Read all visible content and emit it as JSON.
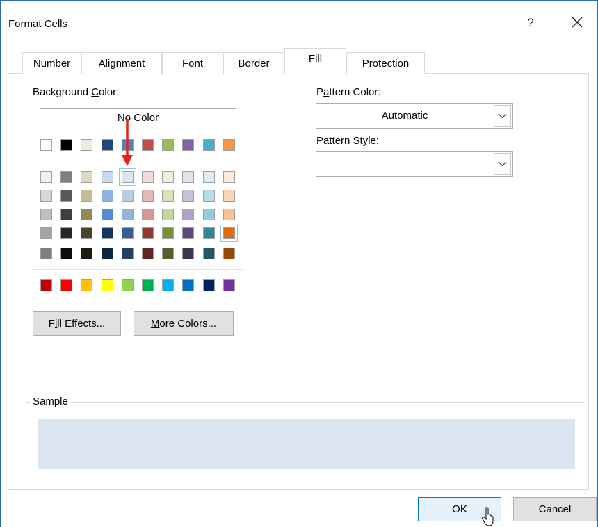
{
  "dialog": {
    "title": "Format Cells",
    "help": "?"
  },
  "tabs": [
    {
      "label": "Number"
    },
    {
      "label": "Alignment"
    },
    {
      "label": "Font"
    },
    {
      "label": "Border"
    },
    {
      "label": "Fill",
      "active": true
    },
    {
      "label": "Protection"
    }
  ],
  "background": {
    "label_pre": "Background ",
    "label_u": "C",
    "label_post": "olor:",
    "no_color": "No Color",
    "selected_color": "#dce6f1",
    "row_theme": [
      "#ffffff",
      "#000000",
      "#eeece1",
      "#1f497d",
      "#4f81bd",
      "#c0504d",
      "#9bbb59",
      "#8064a2",
      "#4bacc6",
      "#f79646"
    ],
    "shades": [
      [
        "#f2f2f2",
        "#7f7f7f",
        "#ddd9c3",
        "#c6d9f0",
        "#dce6f1",
        "#f2dcdb",
        "#ebf1dd",
        "#e5e0ec",
        "#dbeef3",
        "#fdeada"
      ],
      [
        "#d8d8d8",
        "#595959",
        "#c4bd97",
        "#8db3e2",
        "#b8cce4",
        "#e5b9b7",
        "#d7e3bc",
        "#ccc1d9",
        "#b7dde8",
        "#fbd5b5"
      ],
      [
        "#bfbfbf",
        "#3f3f3f",
        "#938953",
        "#548dd4",
        "#95b3d7",
        "#d99694",
        "#c3d69b",
        "#b2a2c7",
        "#92cddc",
        "#fac08f"
      ],
      [
        "#a5a5a5",
        "#262626",
        "#494429",
        "#17365d",
        "#366092",
        "#953734",
        "#76923c",
        "#5f497a",
        "#31859b",
        "#e36c09"
      ],
      [
        "#7f7f7f",
        "#0c0c0c",
        "#1d1b10",
        "#0f243e",
        "#244061",
        "#632423",
        "#4f6128",
        "#3f3151",
        "#205867",
        "#974806"
      ]
    ],
    "standard": [
      "#c00000",
      "#ff0000",
      "#ffc000",
      "#ffff00",
      "#92d050",
      "#00b050",
      "#00b0f0",
      "#0070c0",
      "#002060",
      "#7030a0"
    ]
  },
  "buttons": {
    "fill_effects_pre": "F",
    "fill_effects_u": "i",
    "fill_effects_post": "ll Effects...",
    "more_colors_u": "M",
    "more_colors_post": "ore Colors...",
    "ok": "OK",
    "cancel": "Cancel"
  },
  "pattern": {
    "color_label_pre": "P",
    "color_label_u": "a",
    "color_label_post": "ttern Color:",
    "color_value": "Automatic",
    "style_label_u": "P",
    "style_label_post": "attern Style:",
    "style_value": ""
  },
  "sample": {
    "label": "Sample",
    "color": "#dce6f1"
  },
  "icons": {
    "close": "close-icon",
    "dropdown": "chevron-down-icon",
    "cursor": "mouse-pointer-icon",
    "annotation": "red-arrow-icon"
  }
}
